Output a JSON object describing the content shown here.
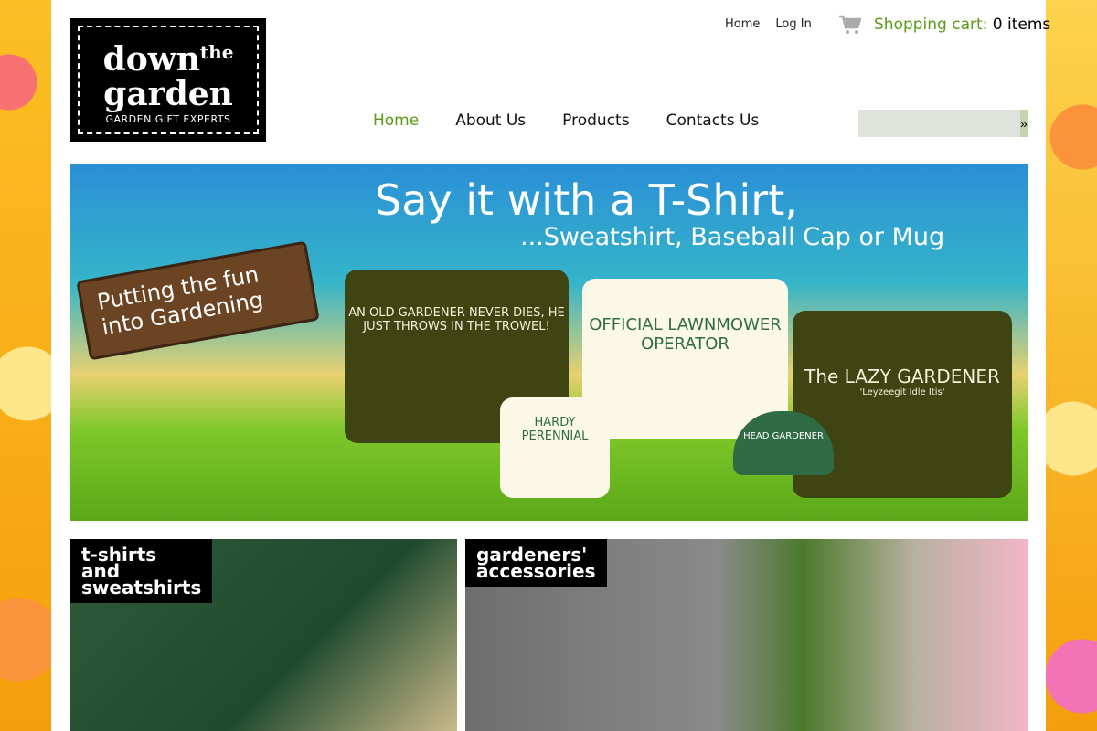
{
  "logo": {
    "line1": "down",
    "sup": "the",
    "line2": "garden",
    "tagline": "GARDEN GIFT EXPERTS"
  },
  "top_links": {
    "home": "Home",
    "login": "Log In"
  },
  "cart": {
    "label": "Shopping cart:",
    "count": "0 items"
  },
  "nav": [
    "Home",
    "About Us",
    "Products",
    "Contacts Us"
  ],
  "search": {
    "placeholder": "",
    "button": "»"
  },
  "banner": {
    "title": "Say it with a T-Shirt,",
    "subtitle": "...Sweatshirt, Baseball Cap or Mug",
    "sign": "Putting the fun into Gardening",
    "shirt1": "AN OLD GARDENER NEVER DIES, HE JUST THROWS IN THE TROWEL!",
    "mug": "HARDY PERENNIAL",
    "shirt2": "OFFICIAL LAWNMOWER OPERATOR",
    "cap": "HEAD GARDENER",
    "shirt3": "The LAZY GARDENER",
    "shirt3_sub": "'Leyzeegit Idle Itis'"
  },
  "categories": [
    {
      "line1": "t-shirts",
      "line2": "and",
      "line3": "sweatshirts"
    },
    {
      "line1": "gardeners'",
      "line2": "accessories"
    }
  ]
}
